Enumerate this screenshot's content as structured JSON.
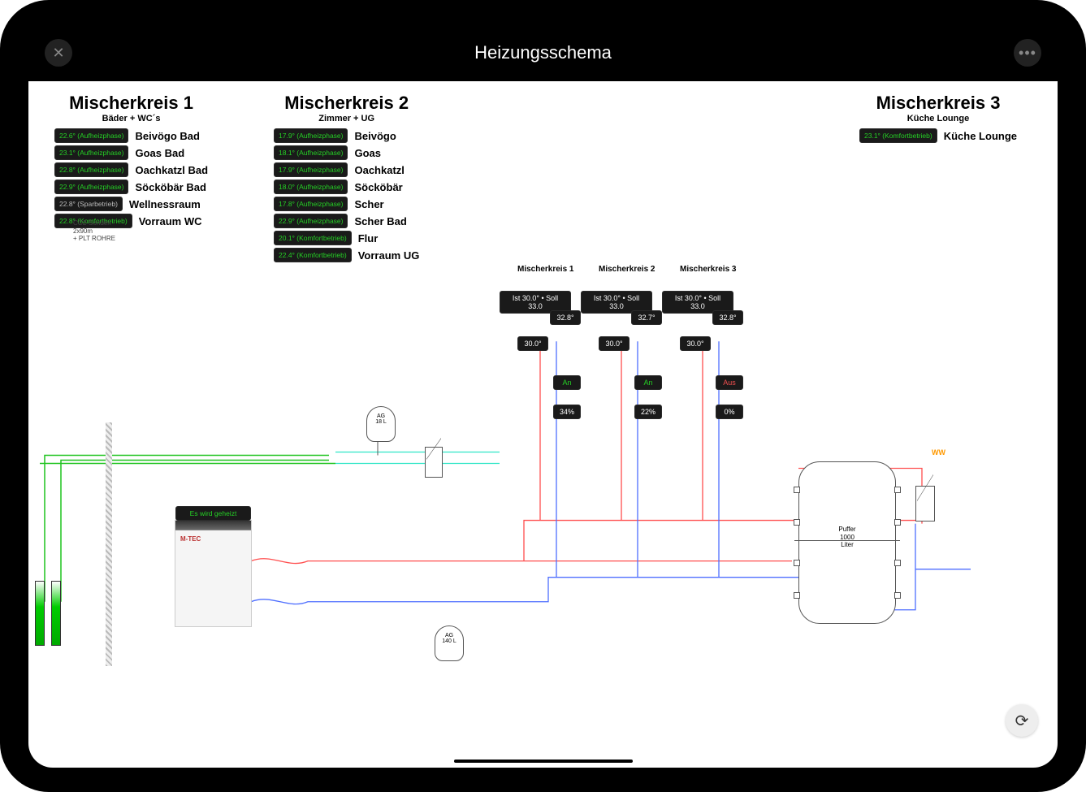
{
  "title": "Heizungsschema",
  "mixer1": {
    "title": "Mischerkreis 1",
    "sub": "Bäder + WC´s",
    "rooms": [
      {
        "badge": "22.6° (Aufheizphase)",
        "cls": "",
        "name": "Beivögo Bad"
      },
      {
        "badge": "23.1° (Aufheizphase)",
        "cls": "",
        "name": "Goas Bad"
      },
      {
        "badge": "22.8° (Aufheizphase)",
        "cls": "",
        "name": "Oachkatzl Bad"
      },
      {
        "badge": "22.9° (Aufheizphase)",
        "cls": "",
        "name": "Söcköbär Bad"
      },
      {
        "badge": "22.8° (Sparbetrieb)",
        "cls": "gray",
        "name": "Wellnessraum"
      },
      {
        "badge": "22.8° (Komfortbetrieb)",
        "cls": "",
        "name": "Vorraum WC"
      }
    ]
  },
  "mixer2": {
    "title": "Mischerkreis 2",
    "sub": "Zimmer + UG",
    "rooms": [
      {
        "badge": "17.9° (Aufheizphase)",
        "cls": "",
        "name": "Beivögo"
      },
      {
        "badge": "18.1° (Aufheizphase)",
        "cls": "",
        "name": "Goas"
      },
      {
        "badge": "17.9° (Aufheizphase)",
        "cls": "",
        "name": "Oachkatzl"
      },
      {
        "badge": "18.0° (Aufheizphase)",
        "cls": "",
        "name": "Söcköbär"
      },
      {
        "badge": "17.8° (Aufheizphase)",
        "cls": "",
        "name": "Scher"
      },
      {
        "badge": "22.9° (Aufheizphase)",
        "cls": "",
        "name": "Scher Bad"
      },
      {
        "badge": "20.1° (Komfortbetrieb)",
        "cls": "",
        "name": "Flur"
      },
      {
        "badge": "22.4° (Komfortbetrieb)",
        "cls": "",
        "name": "Vorraum UG"
      }
    ]
  },
  "mixer3": {
    "title": "Mischerkreis 3",
    "sub": "Küche Lounge",
    "rooms": [
      {
        "badge": "23.1° (Komfortbetrieb)",
        "cls": "",
        "name": "Küche Lounge"
      }
    ]
  },
  "circuits": [
    {
      "name": "Mischerkreis 1",
      "ist_soll": "Ist 30.0° • Soll 33.0",
      "t1": "32.8°",
      "t2": "30.0°",
      "state": "An",
      "state_cls": "green-text",
      "pct": "34%"
    },
    {
      "name": "Mischerkreis 2",
      "ist_soll": "Ist 30.0° • Soll 33.0",
      "t1": "32.7°",
      "t2": "30.0°",
      "state": "An",
      "state_cls": "green-text",
      "pct": "22%"
    },
    {
      "name": "Mischerkreis 3",
      "ist_soll": "Ist 30.0° • Soll 33.0",
      "t1": "32.8°",
      "t2": "30.0°",
      "state": "Aus",
      "state_cls": "red-text",
      "pct": "0%"
    }
  ],
  "heatpump": {
    "status": "Es wird geheizt",
    "brand": "M-TEC"
  },
  "ag_upper": {
    "l1": "AG",
    "l2": "18 L"
  },
  "ag_lower": {
    "l1": "AG",
    "l2": "140 L"
  },
  "buffer": {
    "l1": "Puffer",
    "l2": "1000",
    "l3": "Liter"
  },
  "ww_label": "WW",
  "probes_label": "CO2-Sonden\n2x90m\n+ PLT ROHRE"
}
